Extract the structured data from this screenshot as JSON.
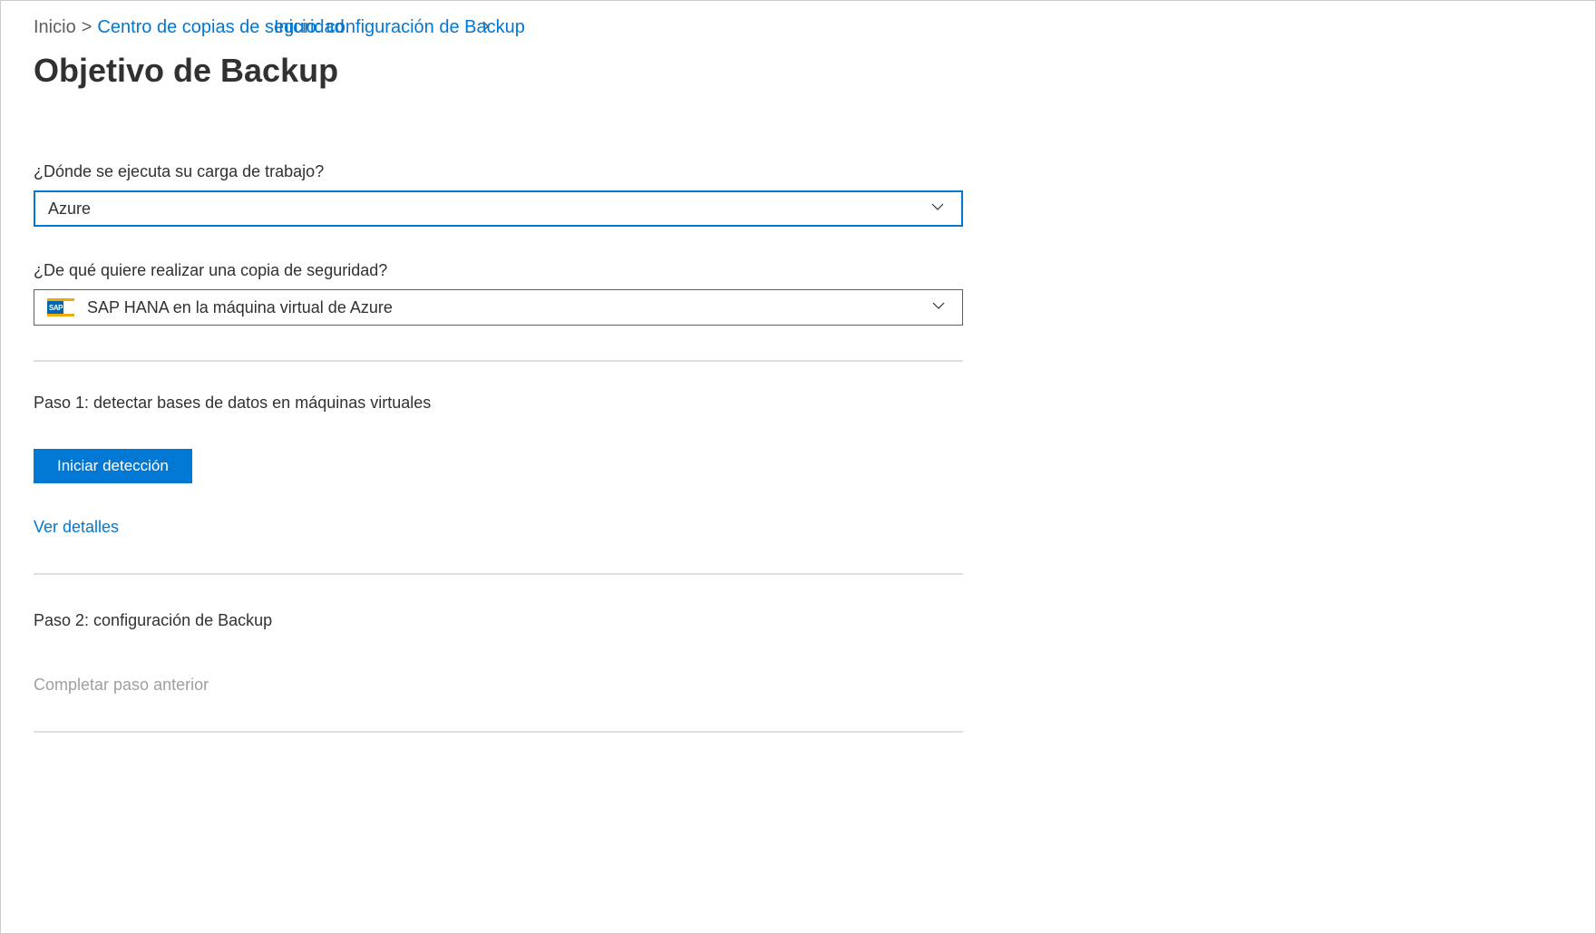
{
  "breadcrumb": {
    "home": "Inicio",
    "separator": ">",
    "link1": "Centro de copias de seguridad",
    "link2": "Inicio: configuración de Backup"
  },
  "page_title": "Objetivo de Backup",
  "form": {
    "workload_label": "¿Dónde se ejecuta su carga de trabajo?",
    "workload_value": "Azure",
    "backup_type_label": "¿De qué quiere realizar una copia de seguridad?",
    "backup_type_value": "SAP HANA en la máquina virtual de Azure",
    "sap_icon_text": "SAP"
  },
  "step1": {
    "heading": "Paso 1: detectar bases de datos en máquinas virtuales",
    "button": "Iniciar detección",
    "link": "Ver detalles"
  },
  "step2": {
    "heading": "Paso 2: configuración de Backup",
    "disabled_text": "Completar paso anterior"
  }
}
